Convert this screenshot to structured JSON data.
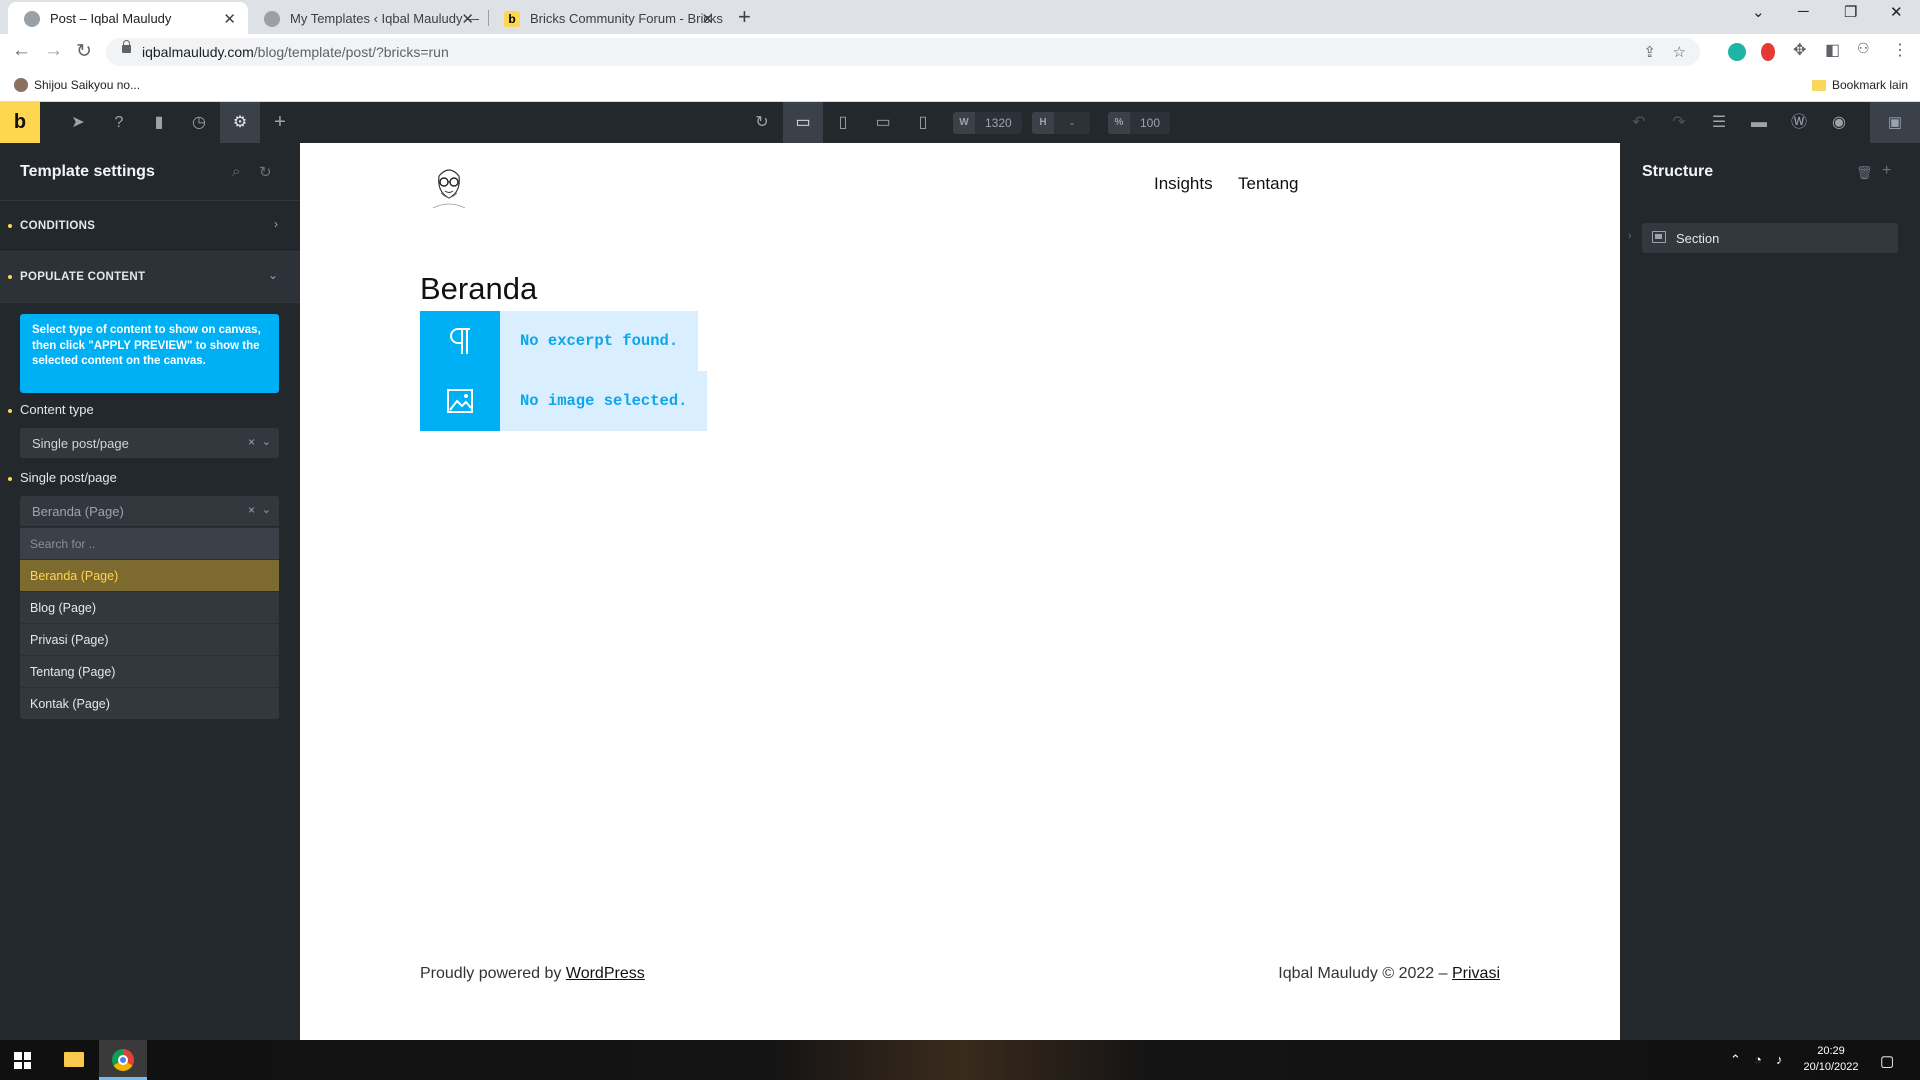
{
  "browser": {
    "tabs": [
      {
        "title": "Post – Iqbal Mauludy",
        "active": true
      },
      {
        "title": "My Templates ‹ Iqbal Mauludy —",
        "active": false
      },
      {
        "title": "Bricks Community Forum - Bricks",
        "active": false
      }
    ],
    "url_host": "iqbalmauludy.com",
    "url_path": "/blog/template/post/?bricks=run",
    "bookmarks": {
      "first": "Shijou Saikyou no...",
      "other": "Bookmark lain"
    }
  },
  "toolbar": {
    "logo": "b",
    "width_label": "W",
    "width_value": "1320",
    "height_label": "H",
    "height_value": "-",
    "zoom_label": "%",
    "zoom_value": "100"
  },
  "left_panel": {
    "title": "Template settings",
    "conditions_label": "CONDITIONS",
    "populate_label": "POPULATE CONTENT",
    "info_text": "Select type of content to show on canvas, then click \"APPLY PREVIEW\" to show the selected content on the canvas.",
    "content_type_label": "Content type",
    "content_type_value": "Single post/page",
    "single_label": "Single post/page",
    "single_value": "Beranda (Page)",
    "search_placeholder": "Search for ..",
    "options": [
      "Beranda (Page)",
      "Blog (Page)",
      "Privasi (Page)",
      "Tentang (Page)",
      "Kontak (Page)"
    ],
    "selected_option": "Beranda (Page)"
  },
  "canvas": {
    "nav": [
      "Insights",
      "Tentang"
    ],
    "page_title": "Beranda",
    "excerpt_placeholder": "No excerpt found.",
    "image_placeholder": "No image selected.",
    "footer_left_prefix": "Proudly powered by",
    "footer_left_link": "WordPress",
    "footer_right_prefix": "Iqbal Mauludy © 2022 –",
    "footer_right_link": "Privasi"
  },
  "right_panel": {
    "title": "Structure",
    "items": [
      "Section"
    ]
  },
  "taskbar": {
    "time": "20:29",
    "date": "20/10/2022"
  },
  "colors": {
    "accent": "#ffd64f",
    "builder_dark": "#23282d",
    "placeholder_blue": "#00b0f4"
  }
}
